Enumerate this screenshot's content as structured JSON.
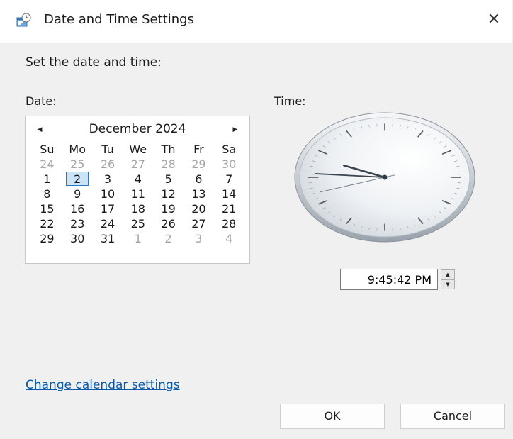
{
  "window": {
    "title": "Date and Time Settings",
    "close_glyph": "✕",
    "icon": "date-time-settings-icon"
  },
  "instruction": "Set the date and time:",
  "date_label": "Date:",
  "time_label": "Time:",
  "calendar": {
    "month_year": "December 2024",
    "prev_glyph": "◀",
    "next_glyph": "▶",
    "weekdays": [
      "Su",
      "Mo",
      "Tu",
      "We",
      "Th",
      "Fr",
      "Sa"
    ],
    "weeks": [
      [
        {
          "d": "24",
          "o": true
        },
        {
          "d": "25",
          "o": true
        },
        {
          "d": "26",
          "o": true
        },
        {
          "d": "27",
          "o": true
        },
        {
          "d": "28",
          "o": true
        },
        {
          "d": "29",
          "o": true
        },
        {
          "d": "30",
          "o": true
        }
      ],
      [
        {
          "d": "1"
        },
        {
          "d": "2",
          "sel": true
        },
        {
          "d": "3"
        },
        {
          "d": "4"
        },
        {
          "d": "5"
        },
        {
          "d": "6"
        },
        {
          "d": "7"
        }
      ],
      [
        {
          "d": "8"
        },
        {
          "d": "9"
        },
        {
          "d": "10"
        },
        {
          "d": "11"
        },
        {
          "d": "12"
        },
        {
          "d": "13"
        },
        {
          "d": "14"
        }
      ],
      [
        {
          "d": "15"
        },
        {
          "d": "16"
        },
        {
          "d": "17"
        },
        {
          "d": "18"
        },
        {
          "d": "19"
        },
        {
          "d": "20"
        },
        {
          "d": "21"
        }
      ],
      [
        {
          "d": "22"
        },
        {
          "d": "23"
        },
        {
          "d": "24"
        },
        {
          "d": "25"
        },
        {
          "d": "26"
        },
        {
          "d": "27"
        },
        {
          "d": "28"
        }
      ],
      [
        {
          "d": "29"
        },
        {
          "d": "30"
        },
        {
          "d": "31"
        },
        {
          "d": "1",
          "o": true
        },
        {
          "d": "2",
          "o": true
        },
        {
          "d": "3",
          "o": true
        },
        {
          "d": "4",
          "o": true
        }
      ]
    ],
    "selected_day": "2"
  },
  "clock": {
    "hour": 9,
    "minute": 45,
    "second": 42
  },
  "time_value": "9:45:42 PM",
  "spin_up_glyph": "▲",
  "spin_down_glyph": "▼",
  "change_calendar_link": "Change calendar settings",
  "buttons": {
    "ok": "OK",
    "cancel": "Cancel"
  },
  "colors": {
    "link": "#0a5aab",
    "selection_fill": "#cce4f7",
    "selection_border": "#2b79c6",
    "other_month_text": "#a5a5a5"
  }
}
